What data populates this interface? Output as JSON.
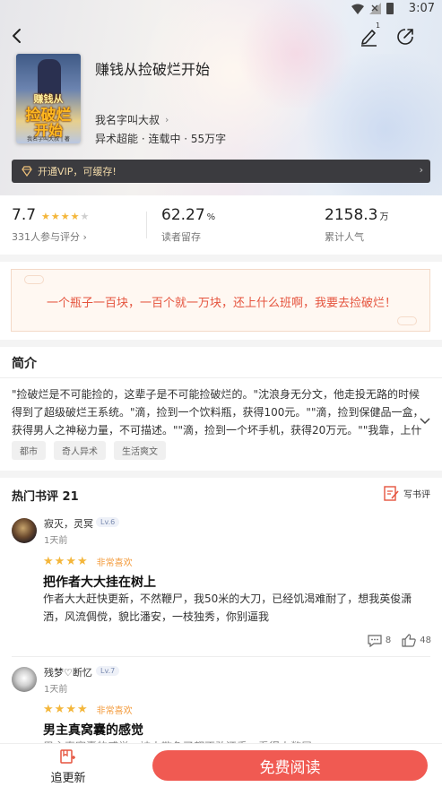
{
  "status_bar": {
    "time": "3:07"
  },
  "header": {
    "edit_count": "1"
  },
  "book": {
    "title": "赚钱从捡破烂开始",
    "author": "我名字叫大叔",
    "meta": "异术超能 · 连载中 · 55万字",
    "cover": {
      "line1": "赚钱从",
      "line2": "捡破烂",
      "line3": "开始",
      "line4": "我名字叫大叔 | 著"
    }
  },
  "vip": {
    "text": "开通VIP，可缓存!"
  },
  "stats": {
    "score": "7.7",
    "score_stars": 4,
    "score_sub": "331人参与评分",
    "retention": "62.27",
    "retention_unit": "%",
    "retention_label": "读者留存",
    "popularity": "2158.3",
    "popularity_unit": "万",
    "popularity_label": "累计人气"
  },
  "quote": "一个瓶子一百块，一百个就一万块，还上什么班啊，我要去捡破烂！",
  "intro": {
    "title": "简介",
    "text": "\"捡破烂是不可能捡的，这辈子是不可能捡破烂的。\"沈浪身无分文，他走投无路的时候得到了超级破烂王系统。\"滴，捡到一个饮料瓶，获得100元。\"\"滴，捡到保健品一盒，获得男人之神秘力量，不可描述。\"\"滴，捡到一个坏手机，获得20万元。\"\"我靠，上什么班，捡破烂",
    "tags": [
      "都市",
      "奇人异术",
      "生活爽文"
    ]
  },
  "reviews": {
    "title": "热门书评 21",
    "write_label": "写书评",
    "items": [
      {
        "user": "寂灭，灵冥",
        "level": "Lv.6",
        "time": "1天前",
        "stars": 4,
        "rating_label": "非常喜欢",
        "title": "把作者大大挂在树上",
        "body": "作者大大赶快更新，不然鞭尸，我50米的大刀，已经饥渴难耐了，想我英俊潇洒，风流倜傥，貌比潘安，一枝独秀，你别逼我",
        "comments": "8",
        "likes": "48"
      },
      {
        "user": "残梦♡断忆",
        "level": "Lv.7",
        "time": "1天前",
        "stars": 4,
        "rating_label": "非常喜欢",
        "title": "男主真窝囊的感觉",
        "body": "男主真窝囊的感觉，被人欺负了都不敢还手，看得人憋屈"
      }
    ]
  },
  "bottom": {
    "follow_label": "追更新",
    "read_label": "免费阅读"
  }
}
